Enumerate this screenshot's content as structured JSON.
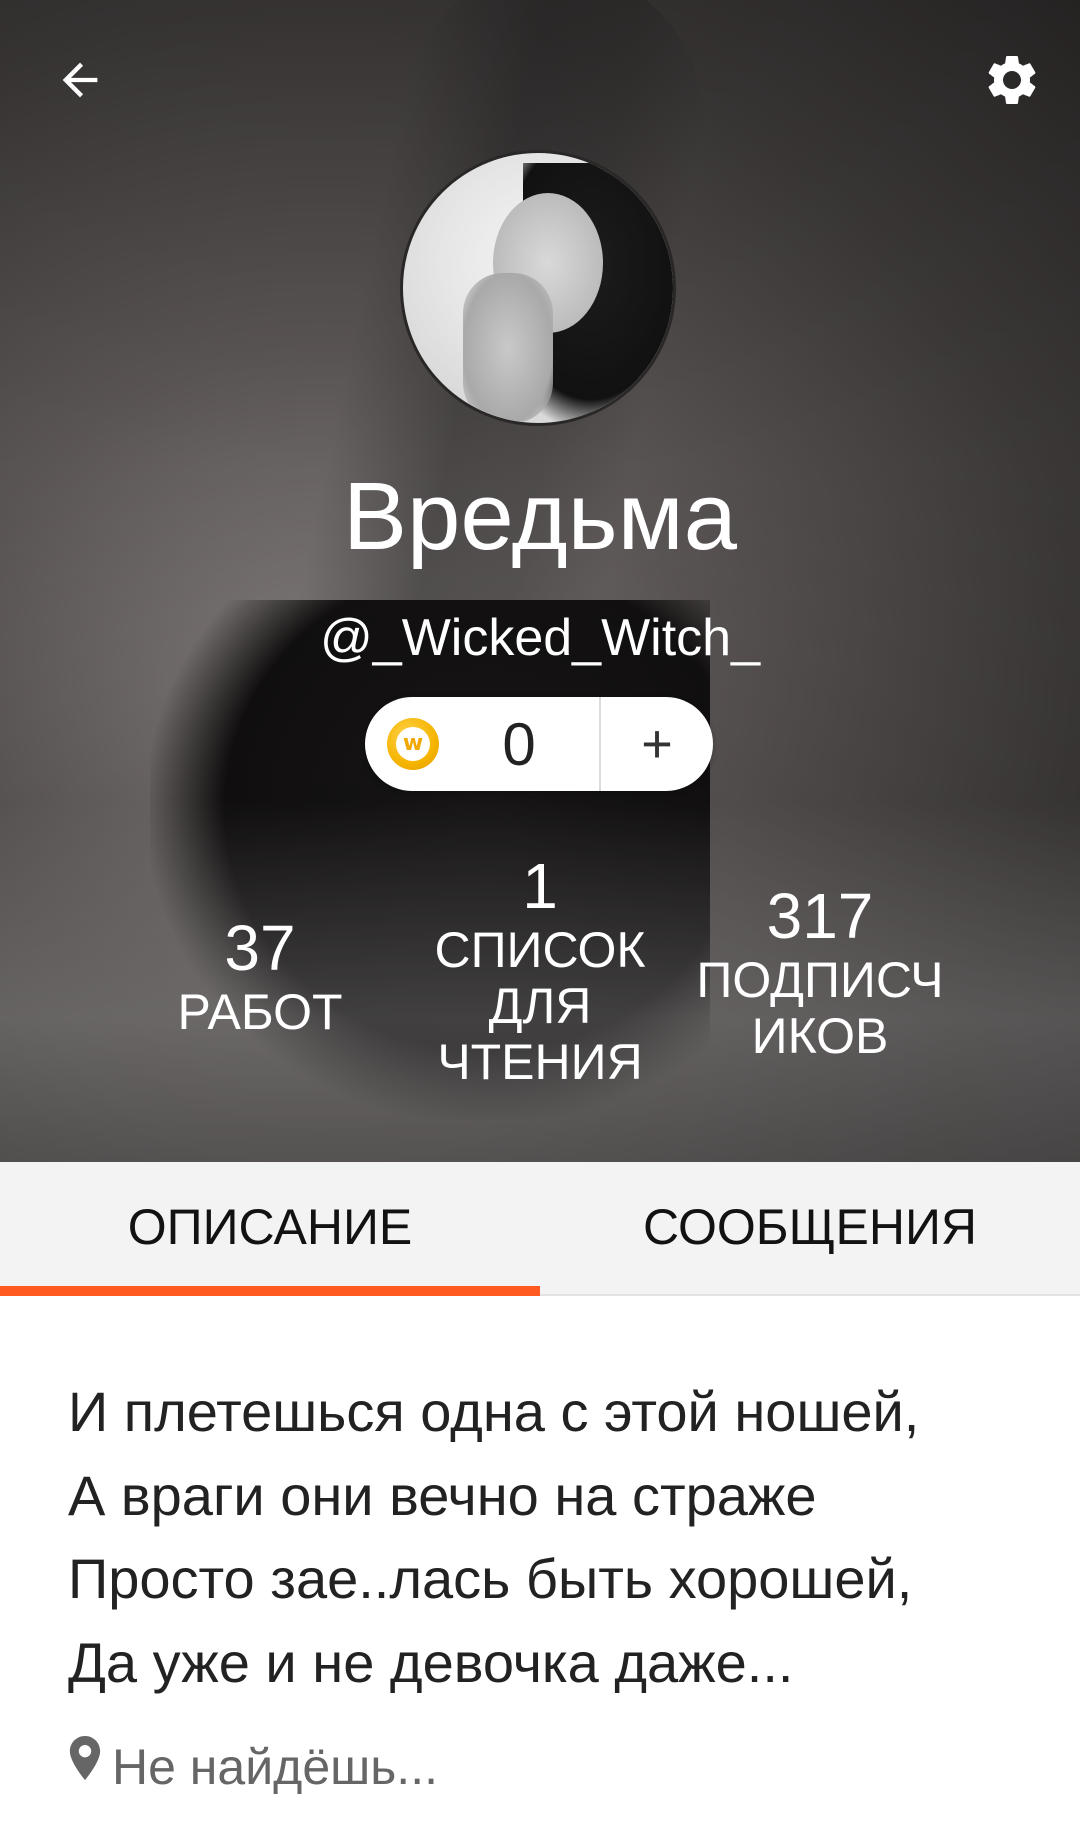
{
  "header": {
    "display_name": "Вредьма",
    "username": "@_Wicked_Witch_"
  },
  "coins": {
    "count": "0",
    "add_label": "+",
    "icon_letter": "w"
  },
  "stats": {
    "works": {
      "value": "37",
      "label": "РАБОТ"
    },
    "reading_lists": {
      "value": "1",
      "label_lines": [
        "СПИСОК",
        "ДЛЯ",
        "ЧТЕНИЯ"
      ]
    },
    "followers": {
      "value": "317",
      "label_lines": [
        "ПОДПИСЧ",
        "ИКОВ"
      ]
    }
  },
  "tabs": {
    "about": "ОПИСАНИЕ",
    "messages": "СООБЩЕНИЯ",
    "active": "about"
  },
  "description": {
    "lines": [
      "И плетешься одна с этой ношей,",
      "А враги они вечно на страже",
      "Просто зае..лась быть хорошей,",
      "Да уже и не девочка даже..."
    ]
  },
  "location": {
    "text": "Не найдёшь..."
  },
  "colors": {
    "accent": "#ff5a1f",
    "coin": "#f5b400"
  },
  "icons": {
    "back": "arrow-left-icon",
    "settings": "gear-icon",
    "coin": "coin-icon",
    "location": "location-pin-icon"
  }
}
